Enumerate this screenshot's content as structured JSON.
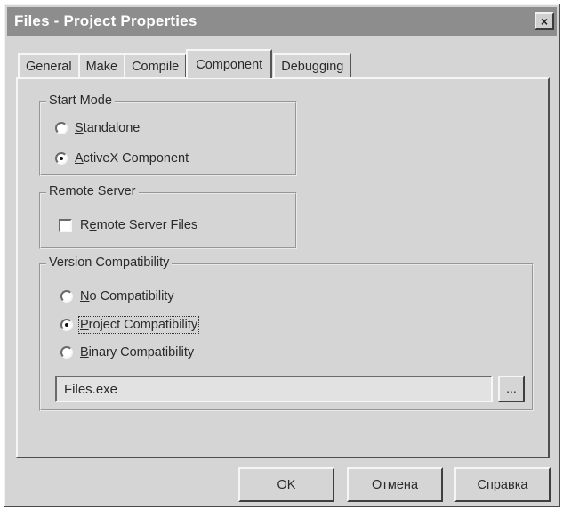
{
  "window": {
    "title": "Files - Project Properties",
    "close_glyph": "×"
  },
  "tabs": [
    {
      "label": "General"
    },
    {
      "label": "Make"
    },
    {
      "label": "Compile"
    },
    {
      "label": "Component",
      "active": true
    },
    {
      "label": "Debugging"
    }
  ],
  "start_mode": {
    "label": "Start Mode",
    "options": [
      {
        "pre": "",
        "u": "S",
        "post": "tandalone",
        "selected": false
      },
      {
        "pre": "",
        "u": "A",
        "post": "ctiveX Component",
        "selected": true
      }
    ]
  },
  "remote_server": {
    "label": "Remote Server",
    "checkbox": {
      "pre": "R",
      "u": "e",
      "post": "mote Server Files",
      "checked": false
    }
  },
  "version_compat": {
    "label": "Version Compatibility",
    "options": [
      {
        "pre": "",
        "u": "N",
        "post": "o Compatibility",
        "selected": false
      },
      {
        "pre": "",
        "u": "P",
        "post": "roject Compatibility",
        "selected": true
      },
      {
        "pre": "",
        "u": "B",
        "post": "inary Compatibility",
        "selected": false
      }
    ],
    "file_value": "Files.exe",
    "browse_label": "..."
  },
  "buttons": {
    "ok": "OK",
    "cancel": "Отмена",
    "help": "Справка"
  }
}
